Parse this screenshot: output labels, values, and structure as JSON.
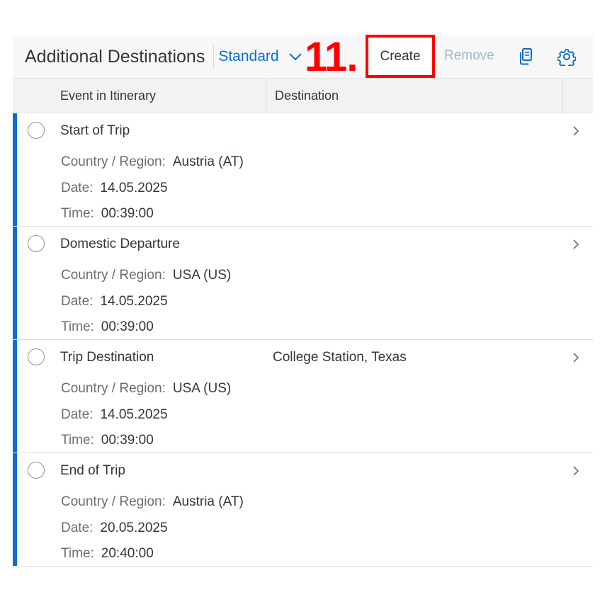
{
  "toolbar": {
    "title": "Additional Destinations",
    "variant": "Standard",
    "step_marker": "11.",
    "create_label": "Create",
    "remove_label": "Remove"
  },
  "table": {
    "headers": {
      "event": "Event in Itinerary",
      "destination": "Destination"
    },
    "labels": {
      "country": "Country / Region:",
      "date": "Date:",
      "time": "Time:"
    },
    "rows": [
      {
        "event": "Start of Trip",
        "destination": "",
        "country": "Austria (AT)",
        "date": "14.05.2025",
        "time": "00:39:00"
      },
      {
        "event": "Domestic Departure",
        "destination": "",
        "country": "USA (US)",
        "date": "14.05.2025",
        "time": "00:39:00"
      },
      {
        "event": "Trip Destination",
        "destination": "College Station, Texas",
        "country": "USA (US)",
        "date": "14.05.2025",
        "time": "00:39:00"
      },
      {
        "event": "End of Trip",
        "destination": "",
        "country": "Austria (AT)",
        "date": "20.05.2025",
        "time": "20:40:00"
      }
    ]
  },
  "colors": {
    "accent": "#0a6ed1",
    "marker": "#ff0000",
    "disabled": "#9fb7cc"
  },
  "icons": [
    "chevron-down-icon",
    "copy-icon",
    "settings-gear-icon",
    "chevron-right-icon"
  ]
}
